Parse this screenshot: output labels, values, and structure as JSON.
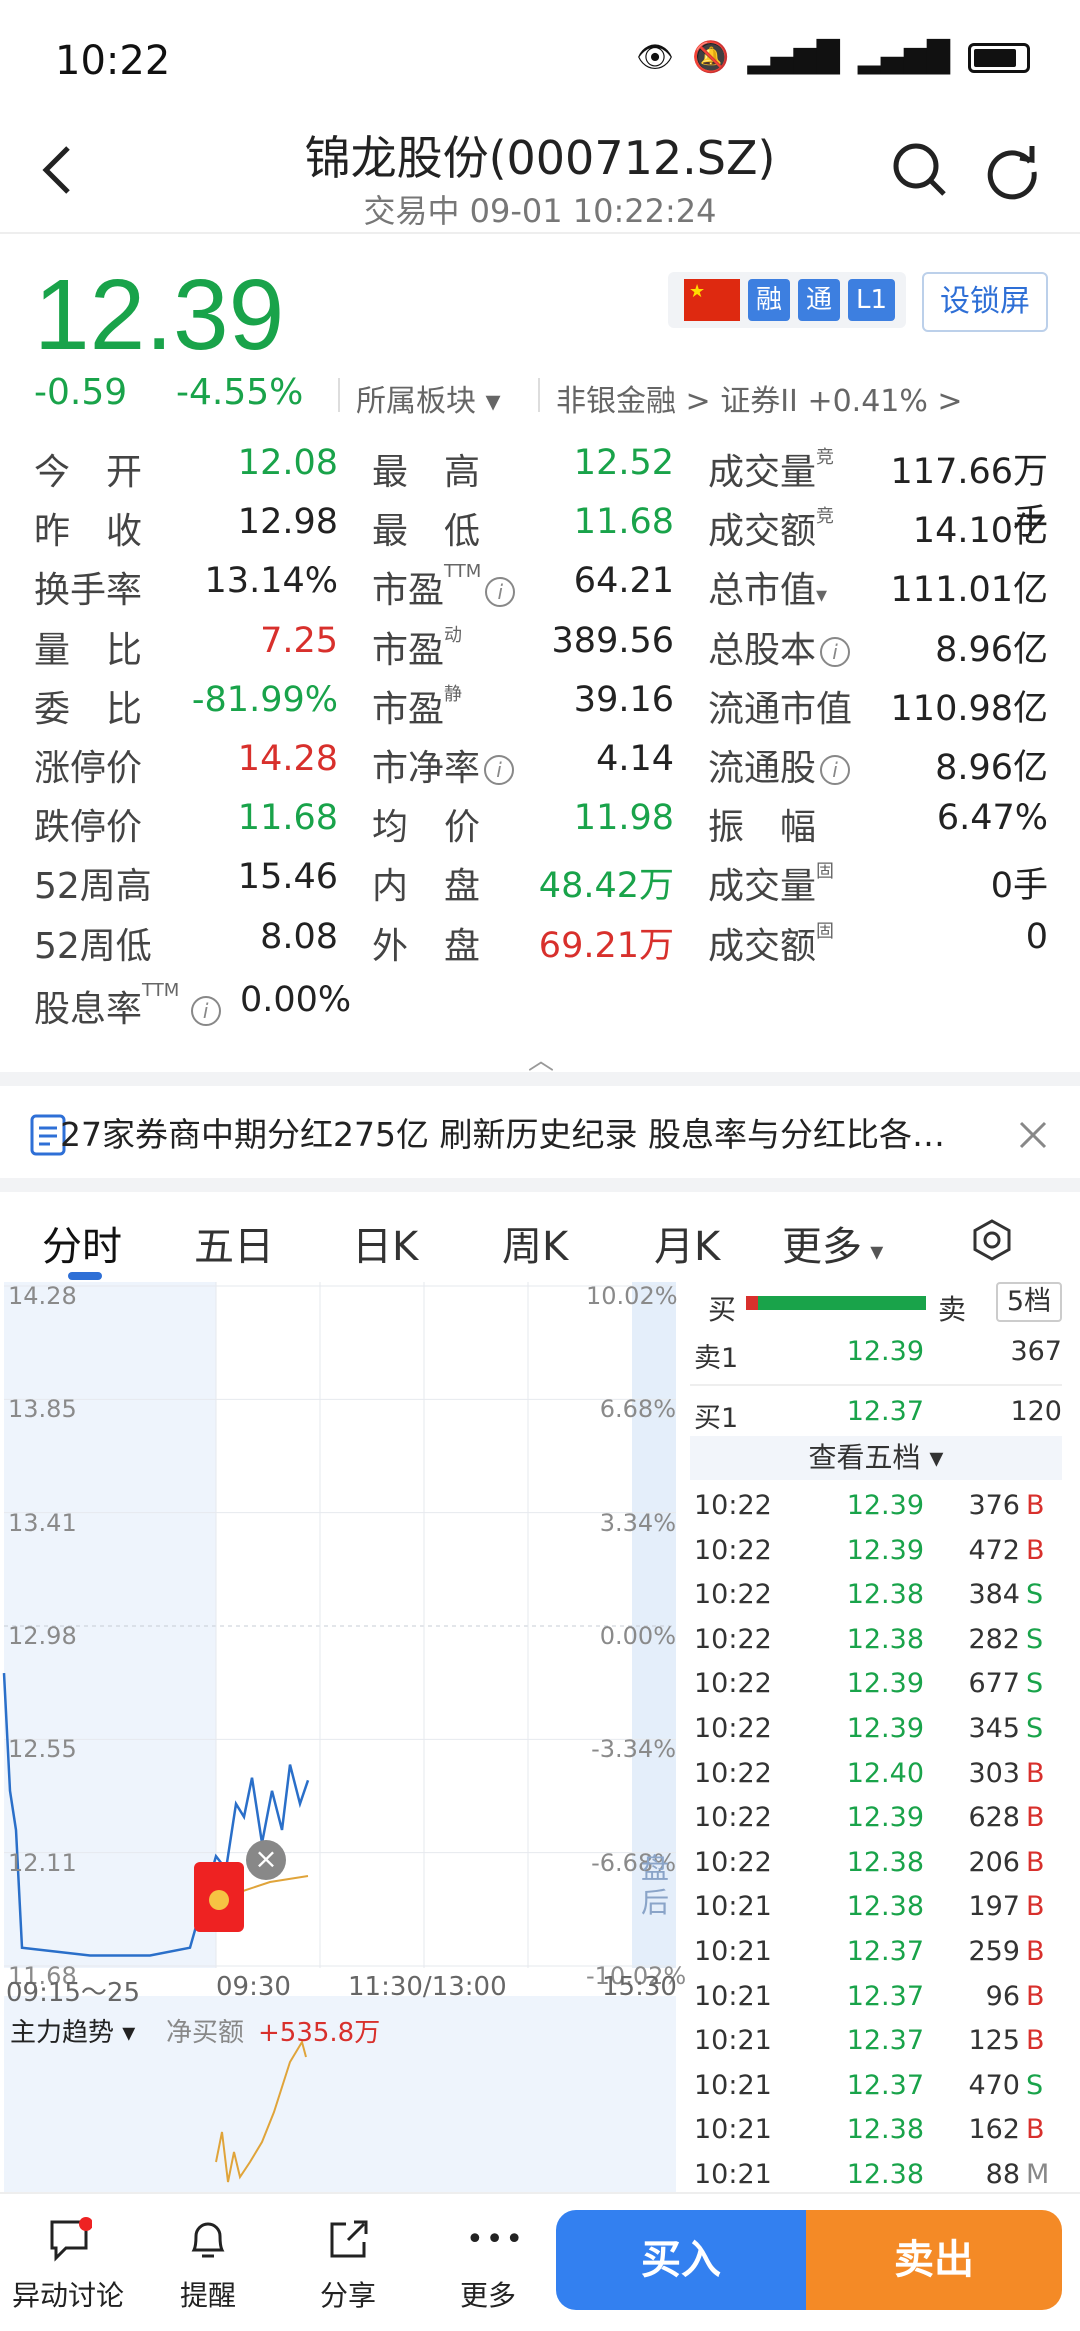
{
  "status": {
    "time": "10:22"
  },
  "header": {
    "title": "锦龙股份(000712.SZ)",
    "subtitle": "交易中 09-01 10:22:24"
  },
  "quote": {
    "price": "12.39",
    "change": "-0.59",
    "change_pct": "-4.55%",
    "sector_label": "所属板块",
    "sector_chain": "非银金融 > 证券II +0.41% >",
    "badges": [
      "融",
      "通",
      "L1"
    ],
    "lock_label": "设锁屏"
  },
  "stats": {
    "col1": [
      {
        "label": "今　开",
        "value": "12.08"
      },
      {
        "label": "昨　收",
        "value": "12.98"
      },
      {
        "label": "换手率",
        "value": "13.14%"
      },
      {
        "label": "量　比",
        "value": "7.25"
      },
      {
        "label": "委　比",
        "value": "-81.99%"
      },
      {
        "label": "涨停价",
        "value": "14.28"
      },
      {
        "label": "跌停价",
        "value": "11.68"
      },
      {
        "label": "52周高",
        "value": "15.46"
      },
      {
        "label": "52周低",
        "value": "8.08"
      }
    ],
    "col2": [
      {
        "label": "最　高",
        "value": "12.52"
      },
      {
        "label": "最　低",
        "value": "11.68"
      },
      {
        "label": "市盈",
        "value": "64.21",
        "sup": "TTM"
      },
      {
        "label": "市盈",
        "value": "389.56",
        "sup": "动"
      },
      {
        "label": "市盈",
        "value": "39.16",
        "sup": "静"
      },
      {
        "label": "市净率",
        "value": "4.14"
      },
      {
        "label": "均　价",
        "value": "11.98"
      },
      {
        "label": "内　盘",
        "value": "48.42万"
      },
      {
        "label": "外　盘",
        "value": "69.21万"
      }
    ],
    "col3": [
      {
        "label": "成交量",
        "value": "117.66万手",
        "sup": "竞"
      },
      {
        "label": "成交额",
        "value": "14.10亿",
        "sup": "竞"
      },
      {
        "label": "总市值",
        "value": "111.01亿"
      },
      {
        "label": "总股本",
        "value": "8.96亿"
      },
      {
        "label": "流通市值",
        "value": "110.98亿"
      },
      {
        "label": "流通股",
        "value": "8.96亿"
      },
      {
        "label": "振　幅",
        "value": "6.47%"
      },
      {
        "label": "成交量",
        "value": "0手",
        "sup": "固"
      },
      {
        "label": "成交额",
        "value": "0",
        "sup": "固"
      }
    ],
    "dividend": {
      "label": "股息率",
      "sup": "TTM",
      "value": "0.00%"
    }
  },
  "news": {
    "text": "27家券商中期分红275亿 刷新历史纪录 股息率与分红比各…"
  },
  "tabs": [
    "分时",
    "五日",
    "日K",
    "周K",
    "月K",
    "更多"
  ],
  "chart": {
    "y_prices": [
      "14.28",
      "13.85",
      "13.41",
      "12.98",
      "12.55",
      "12.11",
      "11.68"
    ],
    "y_pcts": [
      "10.02%",
      "6.68%",
      "3.34%",
      "0.00%",
      "-3.34%",
      "-6.68%",
      "-10.02%"
    ],
    "x_labels": [
      "09:15～25",
      "09:30",
      "11:30/13:00",
      "15:30"
    ],
    "after_hours": "盘后",
    "flow_label": "主力趋势",
    "net_buy_label": "净买额",
    "net_buy_value": "+535.8万"
  },
  "chart_data": {
    "type": "line",
    "title": "",
    "ylim": [
      11.68,
      14.28
    ],
    "prev_close": 12.98,
    "series": [
      {
        "x": [
          "09:15",
          "09:20",
          "09:25",
          "09:26",
          "09:27",
          "09:28",
          "09:29",
          "09:30",
          "09:31",
          "09:32",
          "09:33",
          "09:34",
          "09:35",
          "09:36",
          "09:37",
          "09:38",
          "09:39",
          "09:40"
        ],
        "y": [
          12.8,
          12.35,
          12.2,
          11.75,
          11.72,
          11.72,
          11.75,
          12.1,
          12.05,
          12.3,
          12.25,
          12.4,
          12.15,
          12.35,
          12.2,
          12.45,
          12.3,
          12.39
        ]
      }
    ]
  },
  "book": {
    "buy_label": "买",
    "sell_label": "卖",
    "levels_btn": "5档",
    "ask1": {
      "label": "卖1",
      "price": "12.39",
      "vol": "367"
    },
    "bid1": {
      "label": "买1",
      "price": "12.37",
      "vol": "120"
    },
    "view_five": "查看五档",
    "trades": [
      {
        "t": "10:22",
        "p": "12.39",
        "v": "376",
        "s": "B"
      },
      {
        "t": "10:22",
        "p": "12.39",
        "v": "472",
        "s": "B"
      },
      {
        "t": "10:22",
        "p": "12.38",
        "v": "384",
        "s": "S"
      },
      {
        "t": "10:22",
        "p": "12.38",
        "v": "282",
        "s": "S"
      },
      {
        "t": "10:22",
        "p": "12.39",
        "v": "677",
        "s": "S"
      },
      {
        "t": "10:22",
        "p": "12.39",
        "v": "345",
        "s": "S"
      },
      {
        "t": "10:22",
        "p": "12.40",
        "v": "303",
        "s": "B"
      },
      {
        "t": "10:22",
        "p": "12.39",
        "v": "628",
        "s": "B"
      },
      {
        "t": "10:22",
        "p": "12.38",
        "v": "206",
        "s": "B"
      },
      {
        "t": "10:21",
        "p": "12.38",
        "v": "197",
        "s": "B"
      },
      {
        "t": "10:21",
        "p": "12.37",
        "v": "259",
        "s": "B"
      },
      {
        "t": "10:21",
        "p": "12.37",
        "v": "96",
        "s": "B"
      },
      {
        "t": "10:21",
        "p": "12.37",
        "v": "125",
        "s": "B"
      },
      {
        "t": "10:21",
        "p": "12.37",
        "v": "470",
        "s": "S"
      },
      {
        "t": "10:21",
        "p": "12.38",
        "v": "162",
        "s": "B"
      },
      {
        "t": "10:21",
        "p": "12.38",
        "v": "88",
        "s": "M"
      }
    ]
  },
  "bottom": {
    "items": [
      "异动讨论",
      "提醒",
      "分享",
      "更多"
    ],
    "buy": "买入",
    "sell": "卖出"
  },
  "colors": {
    "up": "#d8302c",
    "down": "#19a34a",
    "accent": "#2e6fd6",
    "sell_btn": "#f48a26",
    "buy_btn": "#3380f0"
  }
}
